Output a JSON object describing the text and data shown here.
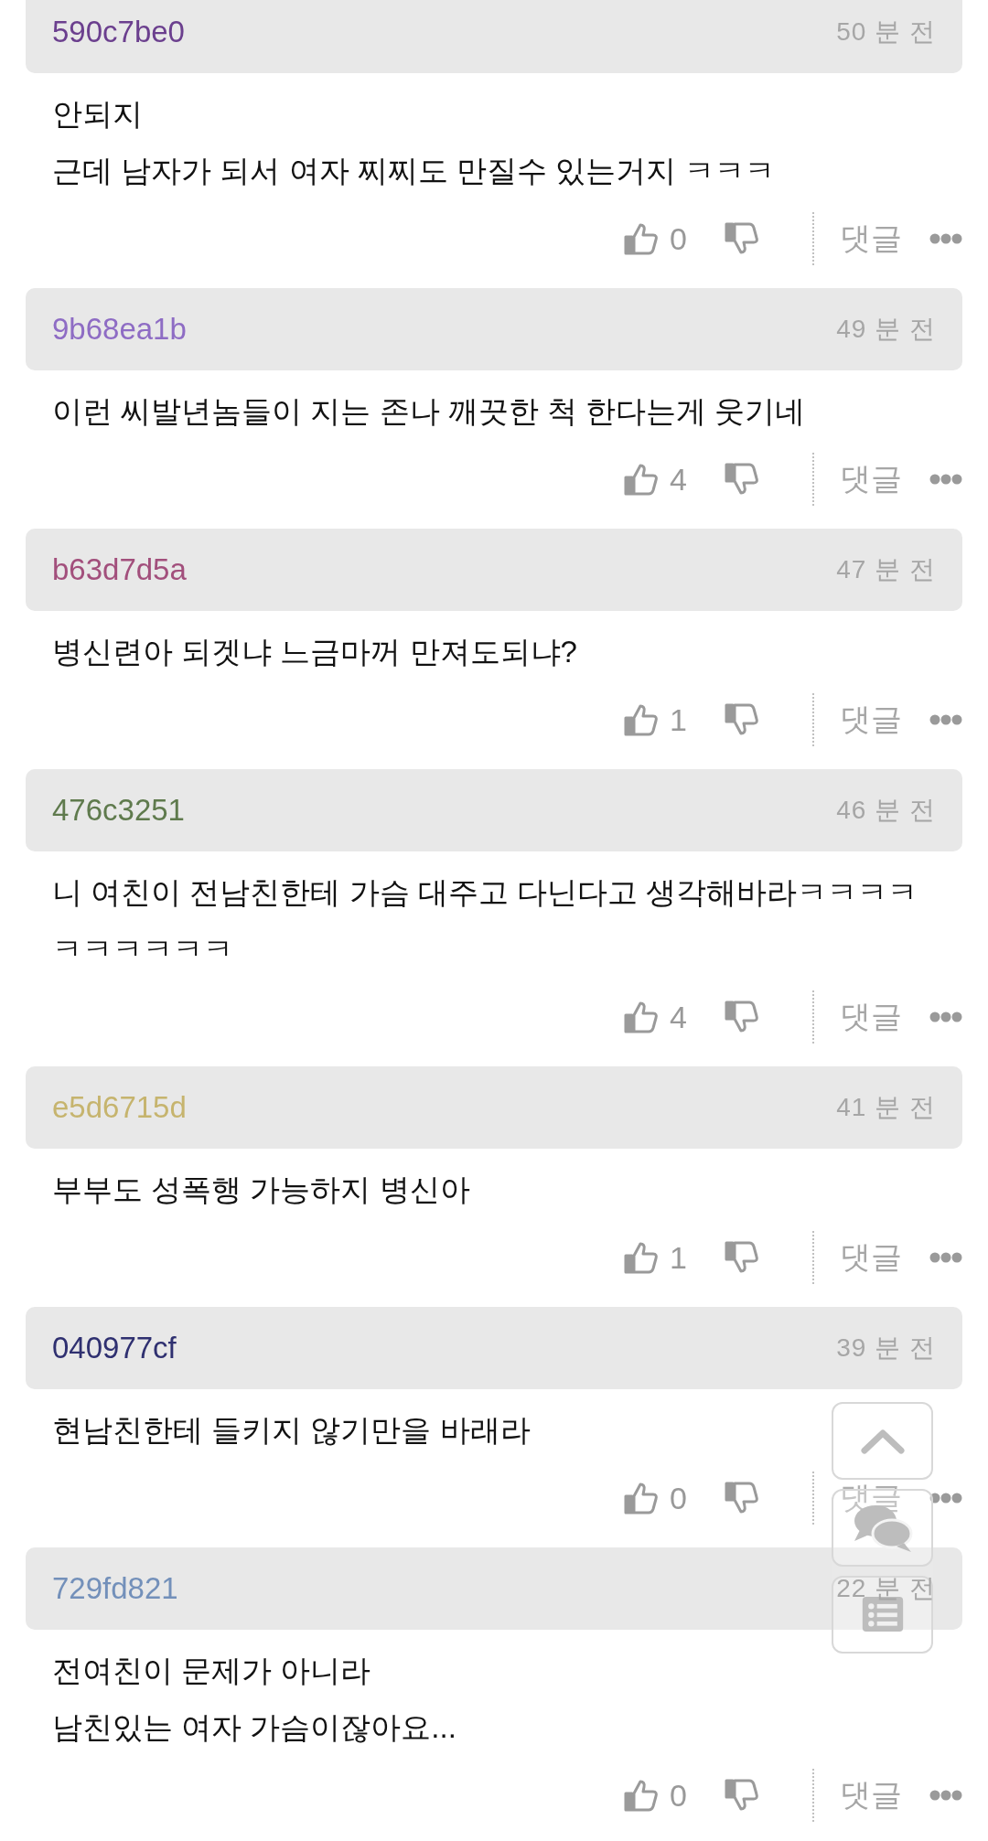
{
  "comments": [
    {
      "user": "590c7be0",
      "color": "#6b3f8e",
      "time": "50 분 전",
      "text": [
        "안되지",
        "근데 남자가 되서 여자 찌찌도 만질수 있는거지 ㅋㅋㅋ"
      ],
      "likes": "0",
      "reply": "댓글"
    },
    {
      "user": "9b68ea1b",
      "color": "#8e6cc4",
      "time": "49 분 전",
      "text": [
        "이런 씨발년놈들이 지는 존나 깨끗한 척 한다는게 웃기네"
      ],
      "likes": "4",
      "reply": "댓글"
    },
    {
      "user": "b63d7d5a",
      "color": "#a24f7c",
      "time": "47 분 전",
      "text": [
        "병신련아 되겟냐 느금마꺼 만져도되냐?"
      ],
      "likes": "1",
      "reply": "댓글"
    },
    {
      "user": "476c3251",
      "color": "#5f7a4d",
      "time": "46 분 전",
      "text": [
        "니 여친이 전남친한테 가슴 대주고 다닌다고 생각해바라ㅋㅋㅋㅋㅋㅋㅋㅋㅋㅋ"
      ],
      "likes": "4",
      "reply": "댓글"
    },
    {
      "user": "e5d6715d",
      "color": "#c6b46e",
      "time": "41 분 전",
      "text": [
        "부부도 성폭행 가능하지 병신아"
      ],
      "likes": "1",
      "reply": "댓글"
    },
    {
      "user": "040977cf",
      "color": "#2f3070",
      "time": "39 분 전",
      "text": [
        "현남친한테 들키지 않기만을 바래라"
      ],
      "likes": "0",
      "reply": "댓글"
    },
    {
      "user": "729fd821",
      "color": "#7390ba",
      "time": "22 분 전",
      "text": [
        "전여친이 문제가 아니라",
        "남친있는 여자 가슴이잖아요..."
      ],
      "likes": "0",
      "reply": "댓글"
    }
  ]
}
